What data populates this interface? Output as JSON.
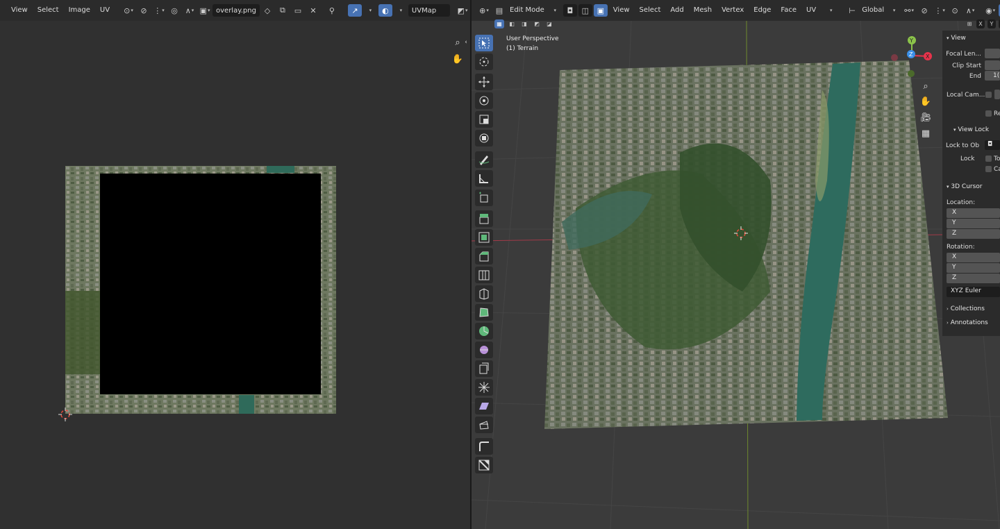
{
  "uv_editor": {
    "menus": [
      "View",
      "Select",
      "Image",
      "UV"
    ],
    "image_name": "overlay.png",
    "uv_map": "UVMap"
  },
  "viewport": {
    "mode": "Edit Mode",
    "menus": [
      "View",
      "Select",
      "Add",
      "Mesh",
      "Vertex",
      "Edge",
      "Face",
      "UV"
    ],
    "orientation": "Global",
    "view_name": "User Perspective",
    "object_name": "(1) Terrain",
    "axes": [
      "X",
      "Y",
      "Z"
    ],
    "gizmo": {
      "x": "X",
      "y": "Y",
      "z": "Z"
    }
  },
  "sidebar": {
    "view_header": "View",
    "focal_length": "Focal Len...",
    "clip_start": "Clip Start",
    "clip_end": "End",
    "clip_end_value": "1(",
    "local_camera": "Local Cam...",
    "render_region": "Re",
    "view_lock_header": "View Lock",
    "lock_to_object": "Lock to Ob",
    "lock": "Lock",
    "lock_to_3d_cursor": "To",
    "lock_camera": "Ca",
    "cursor_header": "3D Cursor",
    "location_label": "Location:",
    "rotation_label": "Rotation:",
    "x": "X",
    "y": "Y",
    "z": "Z",
    "rotation_mode": "XYZ Euler",
    "collections": "Collections",
    "annotations": "Annotations"
  },
  "colors": {
    "accent": "#4772b3",
    "background": "#303030",
    "header": "#2b2b2b",
    "x_axis": "#e8334b",
    "y_axis": "#8bc34a",
    "z_axis": "#3b8fe8"
  }
}
